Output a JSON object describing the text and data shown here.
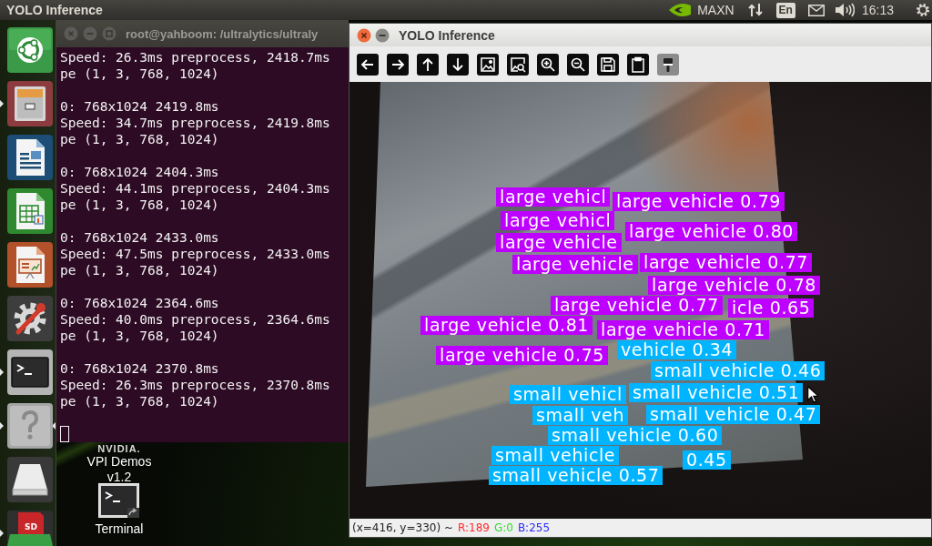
{
  "top_bar": {
    "title": "YOLO Inference",
    "power_mode": "MAXN",
    "keyboard_layout": "En",
    "clock": "16:13"
  },
  "launcher": {
    "items": [
      {
        "kind": "dash",
        "running": false,
        "focused": false
      },
      {
        "kind": "files",
        "running": true,
        "focused": false
      },
      {
        "kind": "writer",
        "running": false,
        "focused": false
      },
      {
        "kind": "calc",
        "running": false,
        "focused": false
      },
      {
        "kind": "impress",
        "running": false,
        "focused": false
      },
      {
        "kind": "settings",
        "running": false,
        "focused": false
      },
      {
        "kind": "terminal",
        "running": true,
        "focused": false
      },
      {
        "kind": "unknown",
        "running": true,
        "focused": true
      },
      {
        "kind": "drive",
        "running": false,
        "focused": false
      },
      {
        "kind": "sd_card",
        "running": true,
        "focused": false,
        "badge": "SD"
      }
    ]
  },
  "terminal": {
    "title": "root@yahboom: /ultralytics/ultraly",
    "blocks": [
      [
        "Speed: 26.3ms preprocess, 2418.7ms",
        "pe (1, 3, 768, 1024)"
      ],
      [
        "0: 768x1024 2419.8ms",
        "Speed: 34.7ms preprocess, 2419.8ms",
        "pe (1, 3, 768, 1024)"
      ],
      [
        "0: 768x1024 2404.3ms",
        "Speed: 44.1ms preprocess, 2404.3ms",
        "pe (1, 3, 768, 1024)"
      ],
      [
        "0: 768x1024 2433.0ms",
        "Speed: 47.5ms preprocess, 2433.0ms",
        "pe (1, 3, 768, 1024)"
      ],
      [
        "0: 768x1024 2364.6ms",
        "Speed: 40.0ms preprocess, 2364.6ms",
        "pe (1, 3, 768, 1024)"
      ],
      [
        "0: 768x1024 2370.8ms",
        "Speed: 26.3ms preprocess, 2370.8ms",
        "pe (1, 3, 768, 1024)"
      ]
    ]
  },
  "desktop_icons": [
    {
      "kind": "vpi",
      "logo": "NVIDIA.",
      "label": "VPI Demos v1.2"
    },
    {
      "kind": "terminal",
      "label": "Terminal"
    }
  ],
  "yolo_window": {
    "title": "YOLO Inference",
    "toolbar": [
      {
        "kind": "arrow_left"
      },
      {
        "kind": "arrow_right"
      },
      {
        "kind": "arrow_up"
      },
      {
        "kind": "arrow_down"
      },
      {
        "kind": "image"
      },
      {
        "kind": "image_zoom"
      },
      {
        "kind": "zoom_in"
      },
      {
        "kind": "zoom_out"
      },
      {
        "kind": "save"
      },
      {
        "kind": "clipboard"
      },
      {
        "kind": "brush"
      }
    ],
    "detections": [
      {
        "label": "large vehicl",
        "color": "#bd00ff"
      },
      {
        "label": "large vehicle 0.79",
        "color": "#bd00ff"
      },
      {
        "label": "large vehicl",
        "color": "#bd00ff"
      },
      {
        "label": "large vehicle 0.80",
        "color": "#bd00ff"
      },
      {
        "label": "large vehicle",
        "color": "#bd00ff"
      },
      {
        "label": "large vehicle",
        "color": "#bd00ff"
      },
      {
        "label": "large vehicle 0.77",
        "color": "#bd00ff"
      },
      {
        "label": "large vehicle 0.78",
        "color": "#bd00ff"
      },
      {
        "label": "large vehicle 0.77",
        "color": "#bd00ff"
      },
      {
        "label": "icle 0.65",
        "color": "#bd00ff"
      },
      {
        "label": "large vehicle 0.81",
        "color": "#bd00ff"
      },
      {
        "label": "large vehicle 0.71",
        "color": "#bd00ff"
      },
      {
        "label": "large vehicle 0.75",
        "color": "#bd00ff"
      },
      {
        "label": "vehicle 0.34",
        "color": "#00b4ff"
      },
      {
        "label": "small vehicle 0.46",
        "color": "#00b4ff"
      },
      {
        "label": "small vehicl",
        "color": "#00b4ff"
      },
      {
        "label": "small vehicle 0.51",
        "color": "#00b4ff"
      },
      {
        "label": "small veh",
        "color": "#00b4ff"
      },
      {
        "label": "small vehicle 0.47",
        "color": "#00b4ff"
      },
      {
        "label": "small vehicle 0.60",
        "color": "#00b4ff"
      },
      {
        "label": "small vehicle",
        "color": "#00b4ff"
      },
      {
        "label": "0.45",
        "color": "#00b4ff"
      },
      {
        "label": "small vehicle 0.57",
        "color": "#00b4ff"
      }
    ],
    "status": {
      "position": "(x=416, y=330) ~",
      "r": "R:189",
      "g": "G:0",
      "b": "B:255"
    }
  }
}
